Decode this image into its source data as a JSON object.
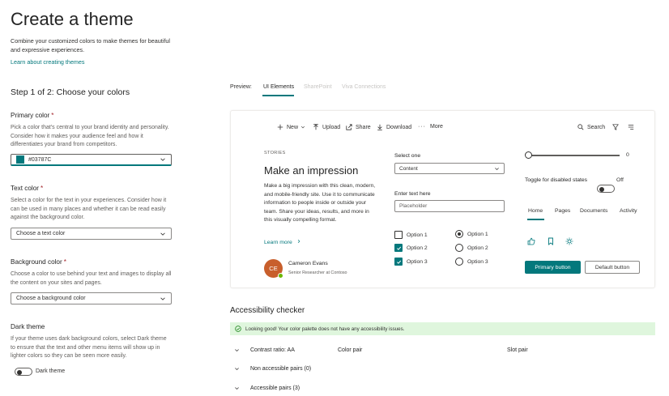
{
  "page": {
    "title": "Create a theme",
    "description": "Combine your customized colors to make themes for beautiful and expressive experiences.",
    "learn_link": "Learn about creating themes",
    "step_title": "Step 1 of 2: Choose your colors"
  },
  "primary_color": {
    "label": "Primary color",
    "required_mark": "*",
    "description": "Pick a color that's central to your brand identity and personality. Consider how it makes your audience feel and how it differentiates your brand from competitors.",
    "value": "#03787C"
  },
  "text_color": {
    "label": "Text color",
    "required_mark": "*",
    "description": "Select a color for the text in your experiences. Consider how it can be used in many places and whether it can be read easily against the background color.",
    "placeholder": "Choose a text color"
  },
  "background_color": {
    "label": "Background color",
    "required_mark": "*",
    "description": "Choose a color to use behind your text and images to display all the content on your sites and pages.",
    "placeholder": "Choose a background color"
  },
  "dark_theme": {
    "label": "Dark theme",
    "description": "If your theme uses dark background colors, select Dark theme to ensure that the text and other menu items will show up in lighter colors so they can be seen more easily.",
    "toggle_label": "Dark theme"
  },
  "preview": {
    "label": "Preview:",
    "tabs": [
      "UI Elements",
      "SharePoint",
      "Viva Connections"
    ]
  },
  "commands": {
    "new": "New",
    "upload": "Upload",
    "share": "Share",
    "download": "Download",
    "more": "More",
    "search": "Search"
  },
  "story": {
    "label": "STORIES",
    "title": "Make an impression",
    "body": "Make a big impression with this clean, modern, and mobile-friendly site. Use it to communicate information to people inside or outside your team. Share your ideas, results, and more in this visually compelling format.",
    "learn_more": "Learn more",
    "person_initials": "CE",
    "person_name": "Cameron Evans",
    "person_role": "Senior Researcher at Contoso"
  },
  "form": {
    "select_label": "Select one",
    "select_value": "Content",
    "text_label": "Enter text here",
    "text_placeholder": "Placeholder",
    "checkboxes": [
      {
        "label": "Option 1",
        "checked": false
      },
      {
        "label": "Option 2",
        "checked": true
      },
      {
        "label": "Option 3",
        "checked": true
      }
    ],
    "radios": [
      {
        "label": "Option 1",
        "selected": true
      },
      {
        "label": "Option 2",
        "selected": false
      },
      {
        "label": "Option 3",
        "selected": false
      }
    ]
  },
  "controls": {
    "slider_value": "0",
    "toggle_label": "Toggle for disabled states",
    "toggle_state": "Off",
    "pivots": [
      "Home",
      "Pages",
      "Documents",
      "Activity"
    ],
    "primary_button": "Primary button",
    "default_button": "Default button"
  },
  "accessibility": {
    "title": "Accessibility checker",
    "banner": "Looking good! Your color palette does not have any accessibility issues.",
    "header_contrast": "Contrast ratio: AA",
    "header_pair": "Color pair",
    "header_slot": "Slot pair",
    "non_accessible": "Non accessible pairs (0)",
    "accessible": "Accessible pairs (3)"
  },
  "colors": {
    "accent": "#03787c",
    "avatar": "#c85f2c",
    "success_bg": "#dff6dd",
    "success_icon": "#107c10"
  }
}
